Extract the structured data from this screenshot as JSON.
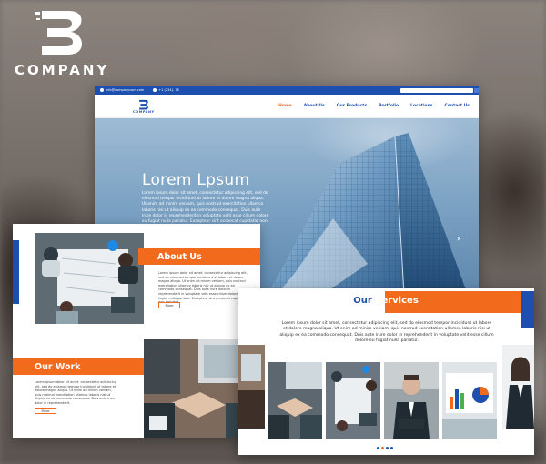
{
  "brand": {
    "logo_word": "COMPANY",
    "nav_logo_word": "COMPANY"
  },
  "colors": {
    "primary_blue": "#1d4fae",
    "accent_orange": "#f26a1b"
  },
  "topbar": {
    "email": "info@companycom.com",
    "phone": "+1 (234)- 78"
  },
  "nav": {
    "items": [
      "Home",
      "About Us",
      "Our Products",
      "Portfolio",
      "Locations",
      "Contact Us"
    ],
    "active": "Home"
  },
  "hero": {
    "title": "Lorem Lpsum",
    "text": "Lorem ipsum dolor sit amet, consectetur adipiscing elit, sed do eiusmod tempor incididunt ut labore et dolore magna aliqua. Ut enim ad minim veniam, quis nostrud exercitation ullamco laboris nisi ut aliquip ex ea commodo consequat. Duis aute irure dolor in reprehenderit in voluptate velit esse cillum dolore eu fugiat nulla pariatur. Excepteur sint occaecat cupidatat non proident, sunt in culpa.",
    "prev_icon": "chevron-left-icon",
    "next_icon": "chevron-right-icon"
  },
  "about": {
    "title": "About Us",
    "text": "Lorem ipsum dolor sit amet, consectetur adipiscing elit, sed do eiusmod tempor incididunt ut labore et dolore magna aliqua. Ut enim ad minim veniam, quis nostrud exercitation ullamco laboris nisi ut aliquip ex ea commodo consequat. Duis aute irure dolor in reprehenderit in voluptate velit esse cillum dolore eu fugiat nulla pariatur. Excepteur sint occaecat cupidatat non proident.",
    "button": "More"
  },
  "work": {
    "title": "Our Work",
    "text": "Lorem ipsum dolor sit amet, consectetur adipiscing elit, sed do eiusmod tempor incididunt ut labore et dolore magna aliqua. Ut enim ad minim veniam, quis nostrud exercitation ullamco laboris nisi ut aliquip ex ea commodo consequat. Duis aute irure dolor in reprehenderit.",
    "button": "More"
  },
  "services": {
    "title_part1": "Our",
    "title_part2": "Services",
    "text": "Lorem ipsum dolor sit amet, consectetur adipiscing elit, sed do eiusmod tempor incididunt ut labore et dolore magna aliqua. Ut enim ad minim veniam, quis nostrud exercitation ullamco laboris nisi ut aliquip ex ea commodo consequat. Duis aute irure dolor in reprehenderit in voluptate velit esse cillum dolore eu fugiat nulla pariatur.",
    "dots_active": 1
  }
}
